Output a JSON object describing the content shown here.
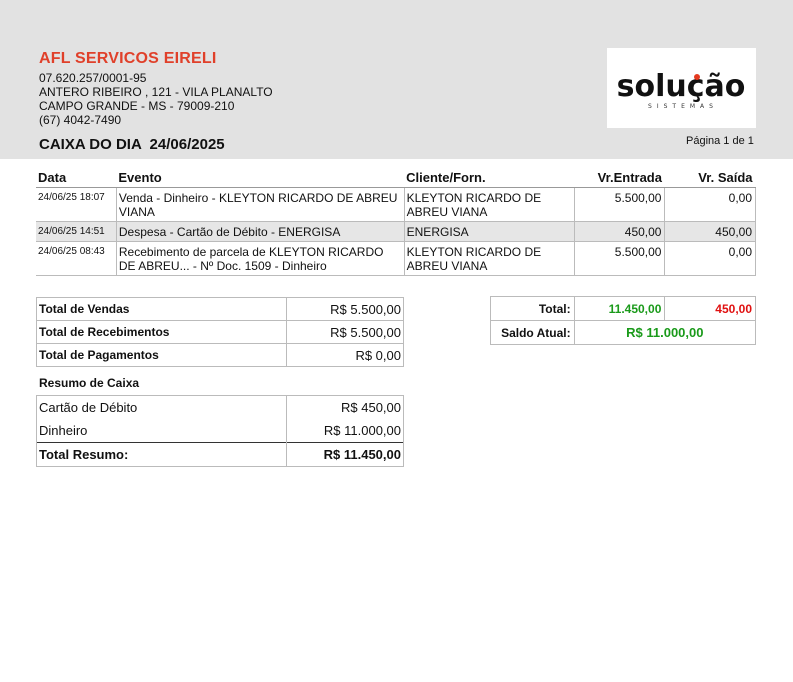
{
  "company": {
    "name": "AFL SERVICOS EIRELI",
    "cnpj": "07.620.257/0001-95",
    "address": "ANTERO RIBEIRO , 121 - VILA PLANALTO",
    "city": "CAMPO GRANDE - MS - 79009-210",
    "phone": "(67) 4042-7490"
  },
  "logo": {
    "text": "solução",
    "subtext": "SISTEMAS"
  },
  "report": {
    "title": "CAIXA DO DIA  24/06/2025",
    "page": "Página 1 de 1"
  },
  "table": {
    "headers": {
      "date": "Data",
      "event": "Evento",
      "client": "Cliente/Forn.",
      "in": "Vr.Entrada",
      "out": "Vr. Saída"
    },
    "rows": [
      {
        "date": "24/06/25 18:07",
        "event": "Venda - Dinheiro - KLEYTON RICARDO DE ABREU VIANA",
        "client": "KLEYTON RICARDO DE ABREU VIANA",
        "in": "5.500,00",
        "out": "0,00"
      },
      {
        "date": "24/06/25 14:51",
        "event": "Despesa - Cartão de Débito - ENERGISA",
        "client": "ENERGISA",
        "in": "450,00",
        "out": "450,00"
      },
      {
        "date": "24/06/25 08:43",
        "event": "Recebimento de parcela de KLEYTON RICARDO DE ABREU... - Nº Doc. 1509 - Dinheiro",
        "client": "KLEYTON RICARDO DE ABREU VIANA",
        "in": "5.500,00",
        "out": "0,00"
      }
    ]
  },
  "totals_left": [
    {
      "label": "Total de Vendas",
      "value": "R$ 5.500,00"
    },
    {
      "label": "Total de Recebimentos",
      "value": "R$ 5.500,00"
    },
    {
      "label": "Total de Pagamentos",
      "value": "R$ 0,00"
    }
  ],
  "resumo": {
    "title": "Resumo de Caixa",
    "items": [
      {
        "label": "Cartão de Débito",
        "value": "R$ 450,00"
      },
      {
        "label": "Dinheiro",
        "value": "R$ 11.000,00"
      }
    ],
    "total_label": "Total Resumo:",
    "total_value": "R$ 11.450,00"
  },
  "totals_right": {
    "total_label": "Total:",
    "total_in": "11.450,00",
    "total_out": "450,00",
    "saldo_label": "Saldo Atual:",
    "saldo_value": "R$ 11.000,00"
  },
  "colors": {
    "company_name": "#e0402a",
    "header_bg": "#e2e2e2",
    "positive": "#1a9a1a",
    "negative": "#e01010"
  }
}
